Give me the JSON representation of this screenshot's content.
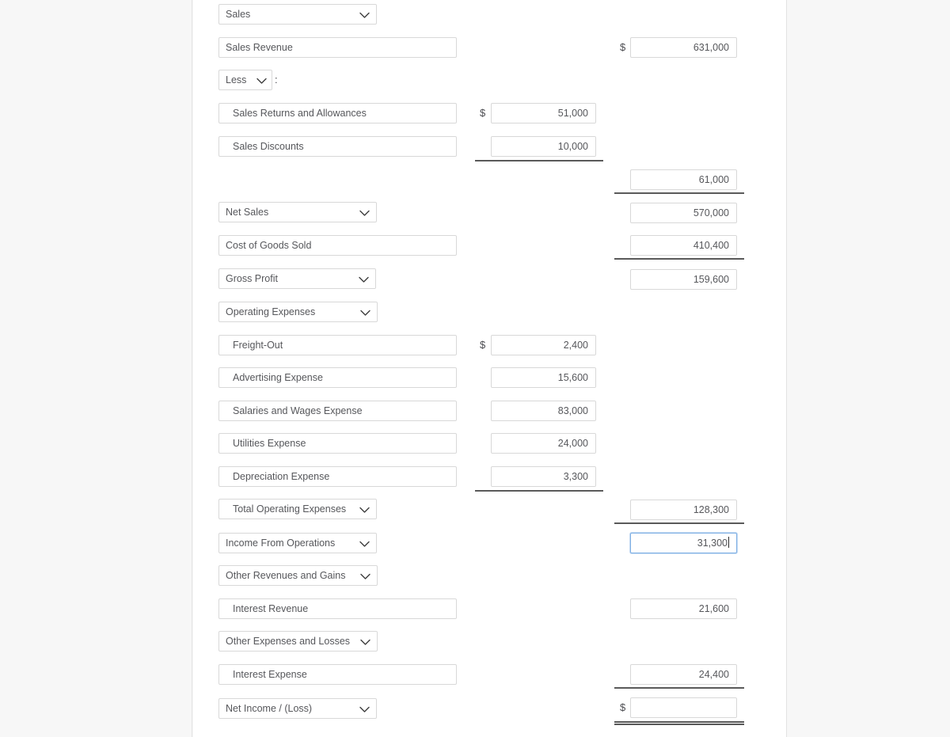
{
  "theme": {
    "page_background": "#f7f7f7",
    "panel_background": "#ffffff",
    "field_border": "#d8d8d8",
    "focus_border": "#7fb0e4",
    "text": "#56575b",
    "rule": "#5a5a5a"
  },
  "symbols": {
    "dollar": "$",
    "colon": ":"
  },
  "rows": [
    {
      "key": "sales_header",
      "label": "Sales"
    },
    {
      "key": "sales_revenue",
      "label": "Sales Revenue",
      "right": "631,000"
    },
    {
      "key": "less",
      "label": "Less"
    },
    {
      "key": "sales_returns",
      "label": "Sales Returns and Allowances",
      "mid": "51,000"
    },
    {
      "key": "sales_discounts",
      "label": "Sales Discounts",
      "mid": "10,000"
    },
    {
      "key": "total_deductions",
      "label": "",
      "right": "61,000"
    },
    {
      "key": "net_sales",
      "label": "Net Sales",
      "right": "570,000"
    },
    {
      "key": "cogs",
      "label": "Cost of Goods Sold",
      "right": "410,400"
    },
    {
      "key": "gross_profit",
      "label": "Gross Profit",
      "right": "159,600"
    },
    {
      "key": "operating_expenses",
      "label": "Operating Expenses"
    },
    {
      "key": "freight_out",
      "label": "Freight-Out",
      "mid": "2,400"
    },
    {
      "key": "advertising",
      "label": "Advertising Expense",
      "mid": "15,600"
    },
    {
      "key": "salaries_wages",
      "label": "Salaries and Wages Expense",
      "mid": "83,000"
    },
    {
      "key": "utilities",
      "label": "Utilities Expense",
      "mid": "24,000"
    },
    {
      "key": "depreciation",
      "label": "Depreciation Expense",
      "mid": "3,300"
    },
    {
      "key": "total_opex",
      "label": "Total Operating Expenses",
      "right": "128,300"
    },
    {
      "key": "income_from_ops",
      "label": "Income From Operations",
      "right": "31,300"
    },
    {
      "key": "other_rev_gains",
      "label": "Other Revenues and Gains"
    },
    {
      "key": "interest_revenue",
      "label": "Interest Revenue",
      "right": "21,600"
    },
    {
      "key": "other_exp_losses",
      "label": "Other Expenses and Losses"
    },
    {
      "key": "interest_expense",
      "label": "Interest Expense",
      "right": "24,400"
    },
    {
      "key": "net_income",
      "label": "Net Income / (Loss)",
      "right": ""
    }
  ],
  "labels": {
    "sales_header": "Sales",
    "sales_revenue": "Sales Revenue",
    "less": "Less",
    "sales_returns": "Sales Returns and Allowances",
    "sales_discounts": "Sales Discounts",
    "net_sales": "Net Sales",
    "cogs": "Cost of Goods Sold",
    "gross_profit": "Gross Profit",
    "operating_expenses": "Operating Expenses",
    "freight_out": "Freight-Out",
    "advertising": "Advertising Expense",
    "salaries_wages": "Salaries and Wages Expense",
    "utilities": "Utilities Expense",
    "depreciation": "Depreciation Expense",
    "total_opex": "Total Operating Expenses",
    "income_from_ops": "Income From Operations",
    "other_rev_gains": "Other Revenues and Gains",
    "interest_revenue": "Interest Revenue",
    "other_exp_losses": "Other Expenses and Losses",
    "interest_expense": "Interest Expense",
    "net_income": "Net Income / (Loss)"
  },
  "amounts": {
    "sales_revenue": "631,000",
    "sales_returns": "51,000",
    "sales_discounts": "10,000",
    "total_deductions": "61,000",
    "net_sales": "570,000",
    "cogs": "410,400",
    "gross_profit": "159,600",
    "freight_out": "2,400",
    "advertising": "15,600",
    "salaries_wages": "83,000",
    "utilities": "24,000",
    "depreciation": "3,300",
    "total_opex": "128,300",
    "income_from_ops": "31,300",
    "interest_revenue": "21,600",
    "interest_expense": "24,400",
    "net_income": ""
  },
  "focused_field": "income_from_ops"
}
